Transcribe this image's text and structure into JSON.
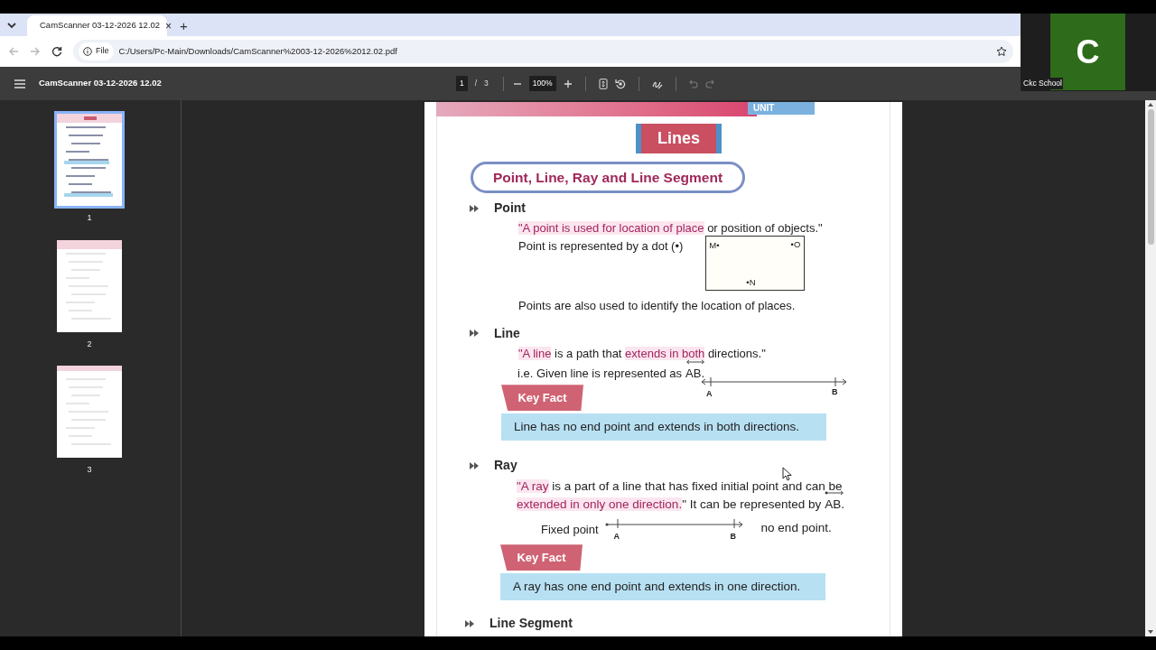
{
  "browser": {
    "tabs": [
      {
        "title": "CamScanner 03-12-2026 12.02",
        "selected": true,
        "close": "×"
      }
    ],
    "new_tab": "+",
    "back_disabled": true,
    "forward_disabled": true,
    "address": {
      "scheme_label": "File",
      "url": "C:/Users/Pc-Main/Downloads/CamScanner%2003-12-2026%2012.02.pdf"
    }
  },
  "pdf_toolbar": {
    "title": "CamScanner 03-12-2026 12.02",
    "page": "1",
    "separator": "/",
    "page_count": "3",
    "zoom": "100%",
    "undo_disabled": true,
    "redo_disabled": true
  },
  "thumbnails": [
    {
      "label": "1",
      "selected": true
    },
    {
      "label": "2",
      "selected": false
    },
    {
      "label": "3",
      "selected": false
    }
  ],
  "document": {
    "unit_tab": "UNIT",
    "title": "Lines",
    "heading": "Point, Line, Ray and Line Segment",
    "point": {
      "heading": "Point",
      "definition": [
        {
          "text": "\"A point is used for location of place",
          "highlighted": true
        },
        {
          "text": " or position of objects.\"",
          "highlighted": false
        }
      ],
      "representation": "Point is represented by a dot (•)",
      "diagram_labels": [
        "M•",
        "•O",
        "•N"
      ],
      "note": "Points are also used to identify the location of places."
    },
    "line": {
      "heading": "Line",
      "definition": [
        {
          "text": "\"A line",
          "highlighted": true
        },
        {
          "text": " is a path that ",
          "highlighted": false
        },
        {
          "text": "extends in both",
          "highlighted": true
        },
        {
          "text": " directions.\"",
          "highlighted": false
        }
      ],
      "representation": "i.e. Given line is represented as",
      "notation": "AB.",
      "diagram_labels": [
        "A",
        "B"
      ],
      "key_fact_label": "Key Fact",
      "key_fact": "Line has no end point and extends in both directions."
    },
    "ray": {
      "heading": "Ray",
      "definition": [
        {
          "text": "\"A ray",
          "highlighted": true
        },
        {
          "text": " is a part of a line that has fixed initial point and can be ",
          "highlighted": false
        },
        {
          "text": "extended in only one direction.",
          "highlighted": true
        },
        {
          "text": "\" It can be represented by",
          "highlighted": false
        }
      ],
      "notation": "AB.",
      "fixed_label": "Fixed point",
      "diagram_labels": [
        "A",
        "B"
      ],
      "end_label": "no end point.",
      "key_fact_label": "Key Fact",
      "key_fact": "A ray has one end point and extends in one direction."
    },
    "next_heading": "Line Segment"
  },
  "video_tile": {
    "initial": "C",
    "name": "Ckc School"
  }
}
